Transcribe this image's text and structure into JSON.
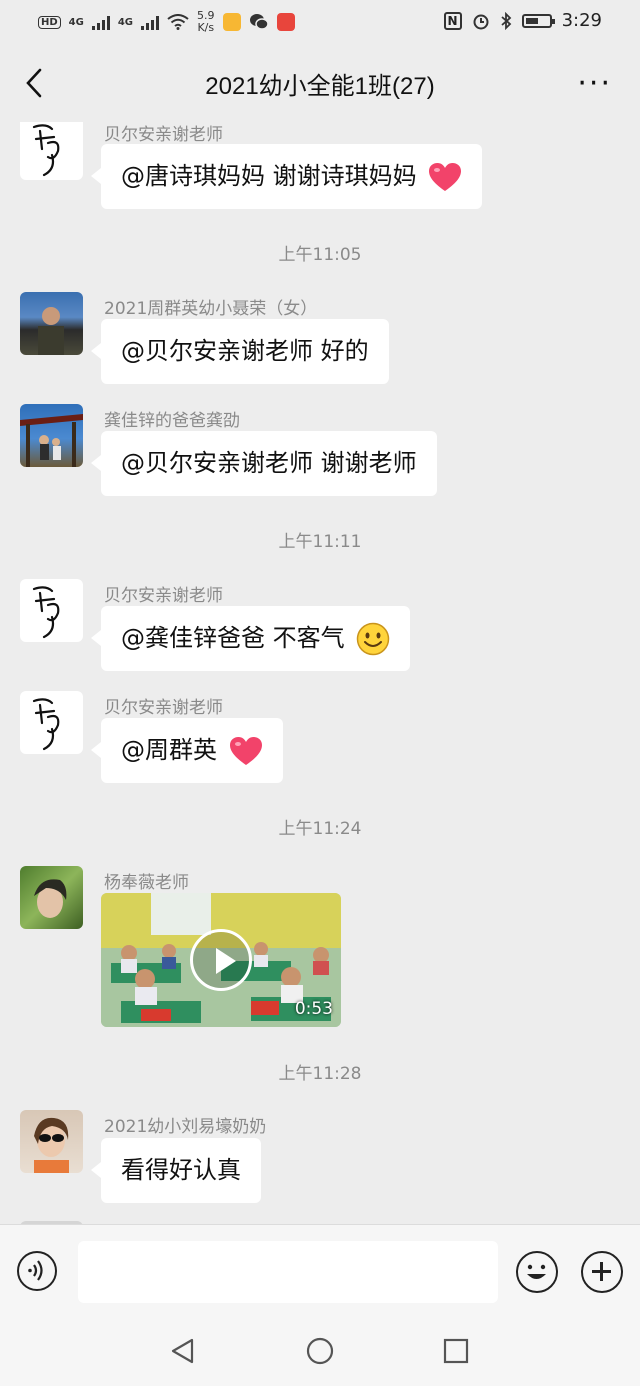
{
  "status_bar": {
    "hd": "HD",
    "net1": "4G",
    "net2": "4G",
    "speed_value": "5.9",
    "speed_unit": "K/s",
    "time": "3:29",
    "nfc": "N"
  },
  "header": {
    "title": "2021幼小全能1班(27)",
    "more": "···"
  },
  "messages": [
    {
      "name": "贝尔安亲谢老师",
      "text": "@唐诗琪妈妈  谢谢诗琪妈妈",
      "emoji": "heart-icon"
    },
    {
      "timestamp": "上午11:05"
    },
    {
      "name": "2021周群英幼小聂荣（女）",
      "text": "@贝尔安亲谢老师  好的"
    },
    {
      "name": "龚佳锌的爸爸龚劭",
      "text": "@贝尔安亲谢老师  谢谢老师"
    },
    {
      "timestamp": "上午11:11"
    },
    {
      "name": "贝尔安亲谢老师",
      "text": "@龚佳锌爸爸  不客气",
      "emoji": "smile-emoji-icon"
    },
    {
      "name": "贝尔安亲谢老师",
      "text": "@周群英 ",
      "emoji": "heart-icon"
    },
    {
      "timestamp": "上午11:24"
    },
    {
      "name": "杨奉薇老师",
      "video_duration": "0:53"
    },
    {
      "timestamp": "上午11:28"
    },
    {
      "name": "2021幼小刘易壕奶奶",
      "text": "看得好认真"
    }
  ],
  "timestamps": [
    "上午11:05",
    "上午11:11",
    "上午11:24",
    "上午11:28"
  ],
  "colors": {
    "background": "#ededed",
    "bubble": "#ffffff",
    "meta_text": "#8a8a8a",
    "heart": "#f2436a"
  },
  "icons": {
    "back": "chevron-left-icon",
    "more": "more-dots-icon",
    "voice": "voice-icon",
    "emoji": "emoji-icon",
    "plus": "plus-icon",
    "nav_back": "triangle-back-icon",
    "nav_home": "circle-home-icon",
    "nav_recent": "square-recent-icon"
  }
}
